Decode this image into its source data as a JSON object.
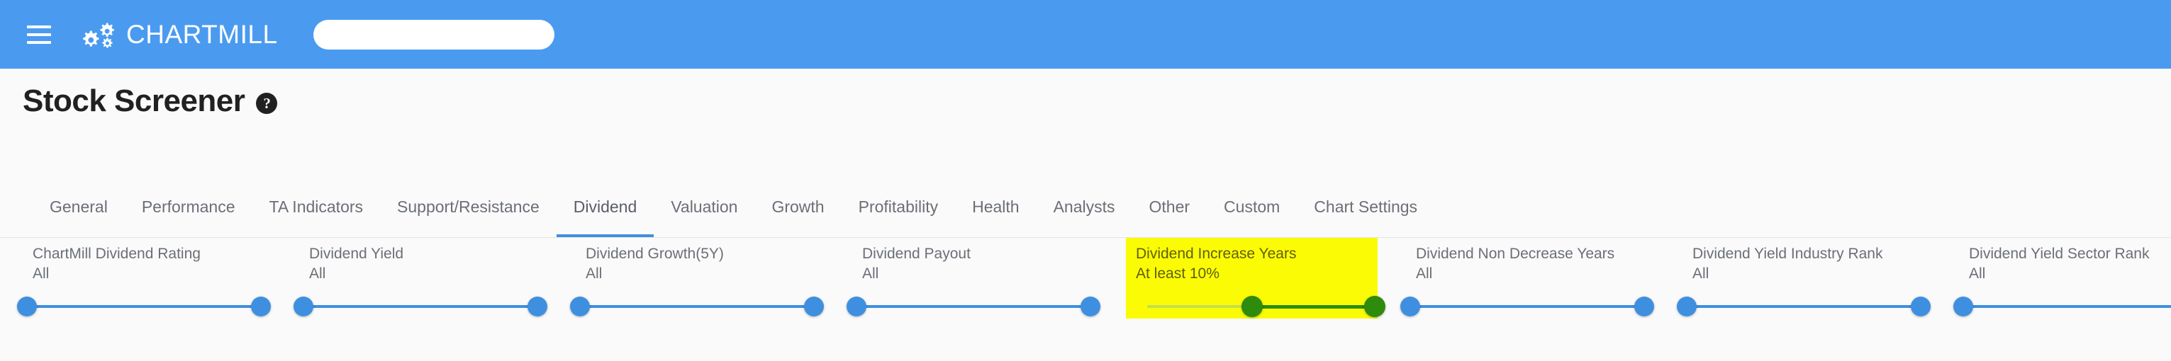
{
  "header": {
    "menu_icon": "hamburger-menu-icon",
    "logo_icon": "gears-logo-icon",
    "brand_name_part1": "C",
    "brand_name_part2": "HART",
    "brand_name_part3": "M",
    "brand_name_part4": "ILL",
    "brand_name": "CHARTMILL",
    "search_value": "",
    "search_placeholder": "",
    "background_color": "#4a9bf0"
  },
  "page": {
    "title": "Stock Screener",
    "help_icon_label": "?",
    "background_color": "#fafafa"
  },
  "tabs": {
    "active": "Dividend",
    "accent_color": "#3f8fe0",
    "items": [
      {
        "label": "General",
        "active": false
      },
      {
        "label": "Performance",
        "active": false
      },
      {
        "label": "TA Indicators",
        "active": false
      },
      {
        "label": "Support/Resistance",
        "active": false
      },
      {
        "label": "Dividend",
        "active": true
      },
      {
        "label": "Valuation",
        "active": false
      },
      {
        "label": "Growth",
        "active": false
      },
      {
        "label": "Profitability",
        "active": false
      },
      {
        "label": "Health",
        "active": false
      },
      {
        "label": "Analysts",
        "active": false
      },
      {
        "label": "Other",
        "active": false
      },
      {
        "label": "Custom",
        "active": false
      },
      {
        "label": "Chart Settings",
        "active": false
      }
    ]
  },
  "filters": {
    "highlight_color": "#fbfb05",
    "slider_color": "#3f8fe0",
    "highlight_slider_color": "#2e8b0b",
    "items": [
      {
        "label": "ChartMill Dividend Rating",
        "value": "All",
        "highlighted": false,
        "min_pct": 0,
        "max_pct": 100
      },
      {
        "label": "Dividend Yield",
        "value": "All",
        "highlighted": false,
        "min_pct": 0,
        "max_pct": 100
      },
      {
        "label": "Dividend Growth(5Y)",
        "value": "All",
        "highlighted": false,
        "min_pct": 0,
        "max_pct": 100
      },
      {
        "label": "Dividend Payout",
        "value": "All",
        "highlighted": false,
        "min_pct": 0,
        "max_pct": 100
      },
      {
        "label": "Dividend Increase Years",
        "value": "At least 10%",
        "highlighted": true,
        "min_pct": 46,
        "max_pct": 100
      },
      {
        "label": "Dividend Non Decrease Years",
        "value": "All",
        "highlighted": false,
        "min_pct": 0,
        "max_pct": 100
      },
      {
        "label": "Dividend Yield Industry Rank",
        "value": "All",
        "highlighted": false,
        "min_pct": 0,
        "max_pct": 100
      },
      {
        "label": "Dividend Yield Sector Rank",
        "value": "All",
        "highlighted": false,
        "min_pct": 0,
        "max_pct": 100
      }
    ]
  }
}
